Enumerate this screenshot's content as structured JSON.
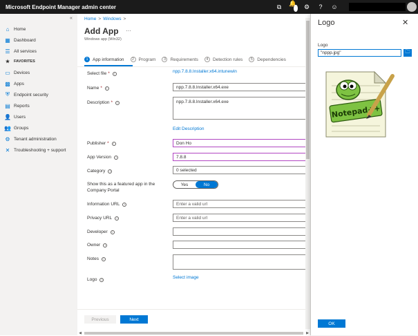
{
  "app_title": "Microsoft Endpoint Manager admin center",
  "topbar": {
    "notification_count": "1"
  },
  "sidebar": {
    "items": [
      {
        "label": "Home",
        "icon": "home-icon"
      },
      {
        "label": "Dashboard",
        "icon": "dashboard-icon"
      },
      {
        "label": "All services",
        "icon": "all-services-icon"
      },
      {
        "label": "FAVORITES",
        "icon": "star-icon"
      },
      {
        "label": "Devices",
        "icon": "devices-icon"
      },
      {
        "label": "Apps",
        "icon": "apps-icon"
      },
      {
        "label": "Endpoint security",
        "icon": "shield-icon"
      },
      {
        "label": "Reports",
        "icon": "reports-icon"
      },
      {
        "label": "Users",
        "icon": "user-icon"
      },
      {
        "label": "Groups",
        "icon": "groups-icon"
      },
      {
        "label": "Tenant administration",
        "icon": "tenant-icon"
      },
      {
        "label": "Troubleshooting + support",
        "icon": "wrench-icon"
      }
    ]
  },
  "breadcrumb": {
    "home": "Home",
    "windows": "Windows"
  },
  "page": {
    "title": "Add App",
    "subtitle": "Windows app (Win32)"
  },
  "steps": [
    {
      "num": "1",
      "label": "App information"
    },
    {
      "num": "2",
      "label": "Program"
    },
    {
      "num": "3",
      "label": "Requirements"
    },
    {
      "num": "4",
      "label": "Detection rules"
    },
    {
      "num": "5",
      "label": "Dependencies"
    }
  ],
  "form": {
    "select_file_label": "Select file",
    "select_file_value": "npp.7.8.8.Installer.x64.intunewin",
    "name_label": "Name",
    "name_value": "npp.7.8.8.Installer.x64.exe",
    "description_label": "Description",
    "description_value": "npp.7.8.8.Installer.x64.exe",
    "edit_description": "Edit Description",
    "publisher_label": "Publisher",
    "publisher_value": "Don Ho",
    "app_version_label": "App Version",
    "app_version_value": "7.8.8",
    "category_label": "Category",
    "category_value": "0 selected",
    "featured_label": "Show this as a featured app in the Company Portal",
    "toggle_yes": "Yes",
    "toggle_no": "No",
    "info_url_label": "Information URL",
    "info_url_placeholder": "Enter a valid url",
    "privacy_url_label": "Privacy URL",
    "privacy_url_placeholder": "Enter a valid url",
    "developer_label": "Developer",
    "owner_label": "Owner",
    "notes_label": "Notes",
    "logo_label": "Logo",
    "select_image": "Select image"
  },
  "footer": {
    "previous": "Previous",
    "next": "Next"
  },
  "panel": {
    "title": "Logo",
    "field_label": "Logo",
    "field_value": "\"nppp.jpg\"",
    "ok": "OK",
    "image_text": "Notepad++"
  }
}
